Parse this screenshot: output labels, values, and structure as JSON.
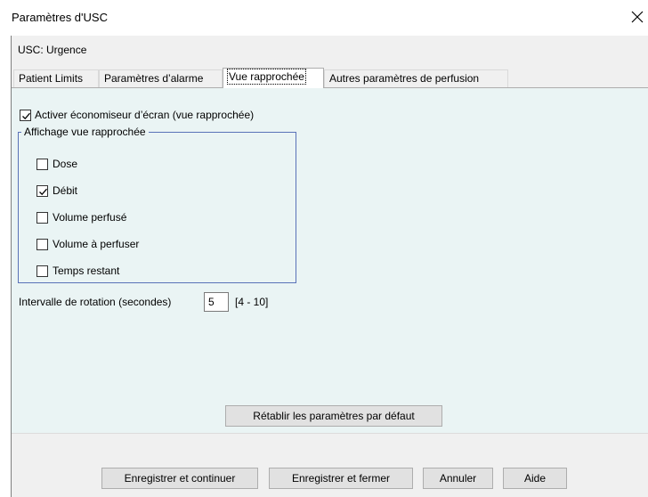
{
  "window": {
    "title": "Paramètres d'USC"
  },
  "header": {
    "usc_label": "USC: Urgence"
  },
  "tabs": [
    {
      "label": "Patient Limits"
    },
    {
      "label": "Paramètres d’alarme"
    },
    {
      "label": "Vue rapprochée",
      "active": true
    },
    {
      "label": "Autres paramètres de perfusion"
    }
  ],
  "screensaver": {
    "label": "Activer économiseur d’écran (vue rapprochée)",
    "checked": true
  },
  "display_group": {
    "legend": "Affichage vue rapprochée",
    "items": [
      {
        "label": "Dose",
        "checked": false
      },
      {
        "label": "Débit",
        "checked": true
      },
      {
        "label": "Volume perfusé",
        "checked": false
      },
      {
        "label": "Volume à perfuser",
        "checked": false
      },
      {
        "label": "Temps restant",
        "checked": false
      }
    ]
  },
  "rotation": {
    "label": "Intervalle de rotation (secondes)",
    "value": "5",
    "range": "[4 - 10]"
  },
  "buttons": {
    "reset": "Rétablir les paramètres par défaut",
    "save_continue": "Enregistrer et continuer",
    "save_close": "Enregistrer et fermer",
    "cancel": "Annuler",
    "help": "Aide"
  },
  "colors": {
    "panel_bg": "#eaf4f4",
    "dialog_bg": "#f0f0f0",
    "groupbox_border": "#5a72b8"
  }
}
